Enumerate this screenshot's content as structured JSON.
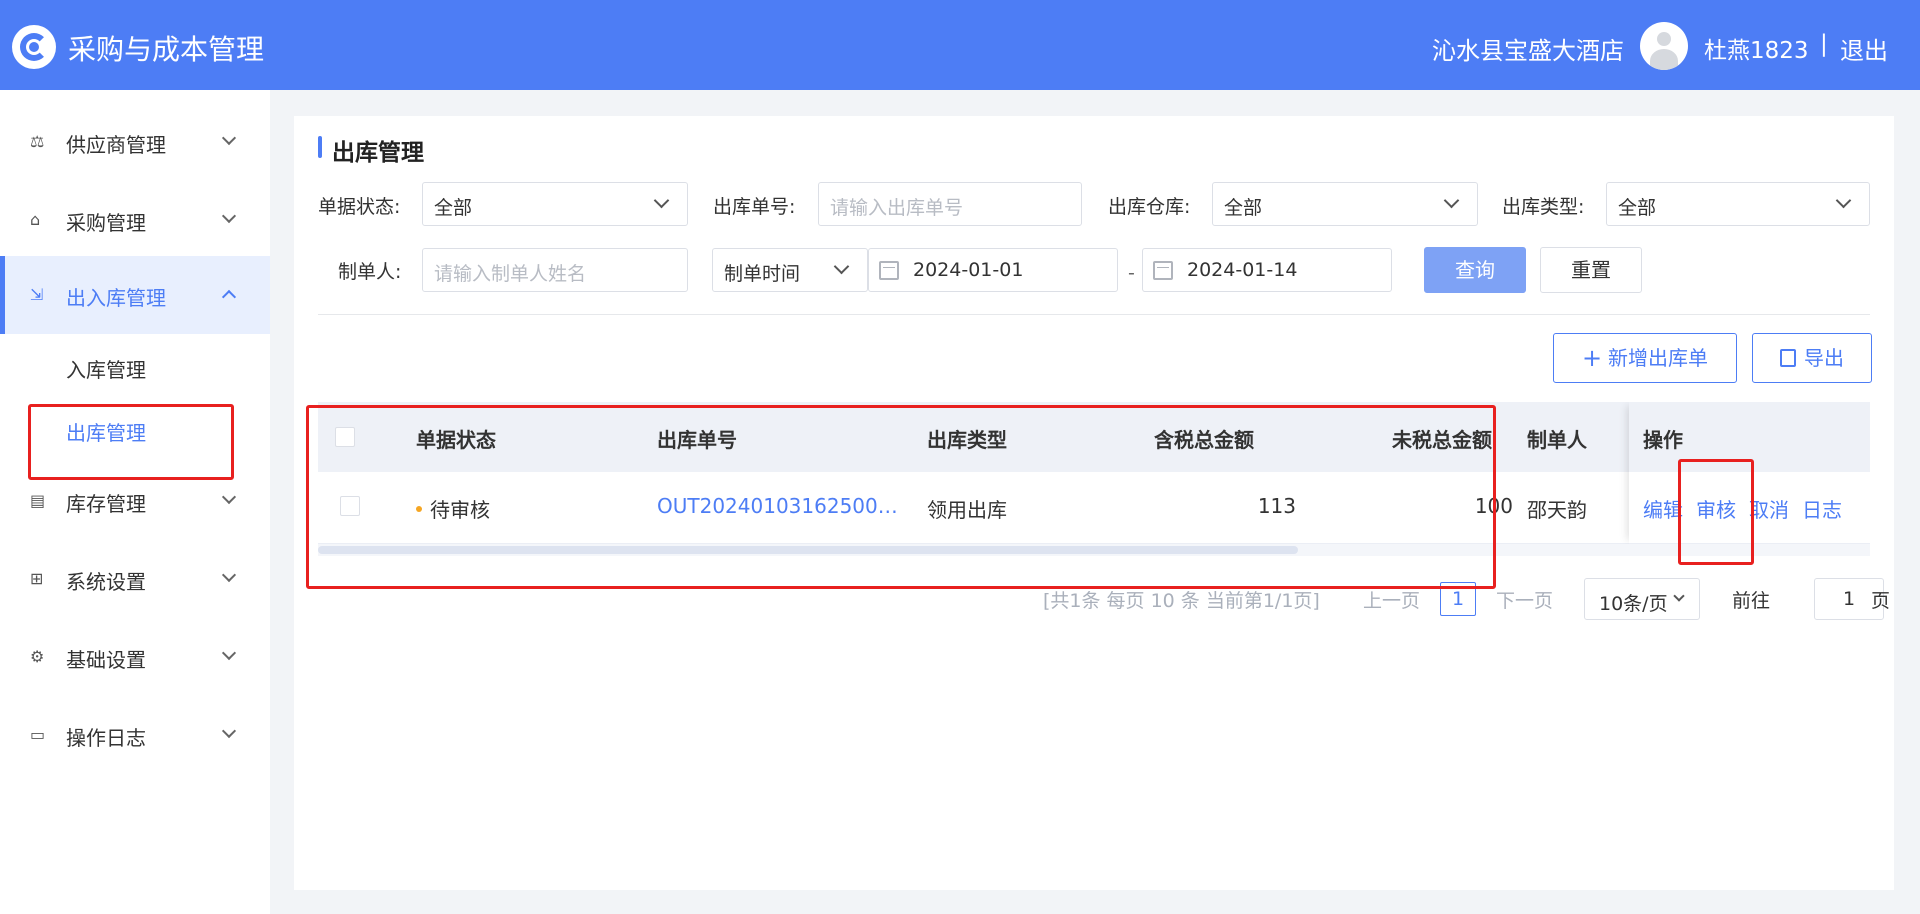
{
  "header": {
    "app_title": "采购与成本管理",
    "hotel": "沁水县宝盛大酒店",
    "username": "杜燕1823",
    "separator": "|",
    "logout": "退出"
  },
  "sidebar": {
    "items": [
      {
        "label": "供应商管理",
        "icon": "supplier-icon"
      },
      {
        "label": "采购管理",
        "icon": "purchase-icon"
      },
      {
        "label": "出入库管理",
        "icon": "inout-icon",
        "expanded": true
      },
      {
        "label": "库存管理",
        "icon": "inventory-icon"
      },
      {
        "label": "系统设置",
        "icon": "system-icon"
      },
      {
        "label": "基础设置",
        "icon": "gear-icon"
      },
      {
        "label": "操作日志",
        "icon": "log-icon"
      }
    ],
    "sub_items": [
      {
        "label": "入库管理"
      },
      {
        "label": "出库管理",
        "active": true
      }
    ]
  },
  "page": {
    "title": "出库管理"
  },
  "filters": {
    "status_label": "单据状态:",
    "status_value": "全部",
    "order_no_label": "出库单号:",
    "order_no_placeholder": "请输入出库单号",
    "warehouse_label": "出库仓库:",
    "warehouse_value": "全部",
    "type_label": "出库类型:",
    "type_value": "全部",
    "creator_label": "制单人:",
    "creator_placeholder": "请输入制单人姓名",
    "time_type": "制单时间",
    "date_start": "2024-01-01",
    "date_sep": "-",
    "date_end": "2024-01-14",
    "query_btn": "查询",
    "reset_btn": "重置"
  },
  "actions": {
    "add_btn": "新增出库单",
    "export_btn": "导出"
  },
  "table": {
    "headers": {
      "status": "单据状态",
      "order_no": "出库单号",
      "type": "出库类型",
      "tax_total": "含税总金额",
      "notax_total": "未税总金额",
      "creator": "制单人",
      "ops": "操作"
    },
    "rows": [
      {
        "status": "待审核",
        "order_no": "OUT20240103162500…",
        "type": "领用出库",
        "tax_total": "113",
        "notax_total": "100",
        "creator": "邵天韵",
        "ops": [
          "编辑",
          "审核",
          "取消",
          "日志"
        ]
      }
    ]
  },
  "pagination": {
    "summary": "[共1条 每页 10 条 当前第1/1页]",
    "prev": "上一页",
    "current": "1",
    "next": "下一页",
    "page_size": "10条/页",
    "goto_label": "前往",
    "goto_value": "1",
    "page_unit": "页"
  },
  "colors": {
    "brand": "#4d7df5",
    "header_bg": "#4d7df5",
    "highlight": "#e8201f",
    "pending_dot": "#f5a623"
  }
}
